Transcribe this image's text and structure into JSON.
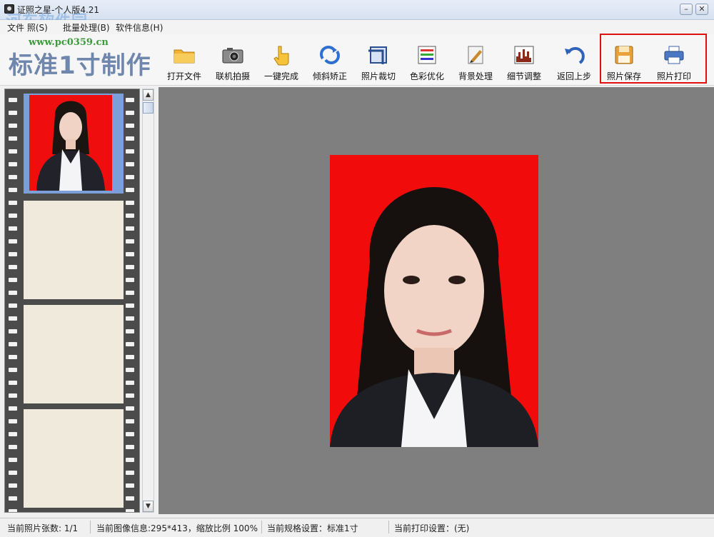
{
  "window": {
    "title": "证照之星-个人版4.21",
    "minimize_symbol": "–",
    "close_symbol": "✕",
    "watermark_text": "河东软件园"
  },
  "menu": [
    {
      "label": "文件 照(S)"
    },
    {
      "label": "批量处理(B)"
    },
    {
      "label": "软件信息(H)"
    }
  ],
  "toolbar": {
    "app_title": "标准1寸制作",
    "site_url": "www.pc0359.cn",
    "buttons": [
      {
        "label": "打开文件",
        "icon": "folder-icon"
      },
      {
        "label": "联机拍摄",
        "icon": "camera-icon"
      },
      {
        "label": "一键完成",
        "icon": "hand-icon"
      },
      {
        "label": "倾斜矫正",
        "icon": "rotate-icon"
      },
      {
        "label": "照片裁切",
        "icon": "crop-icon"
      },
      {
        "label": "色彩优化",
        "icon": "color-icon"
      },
      {
        "label": "背景处理",
        "icon": "brush-icon"
      },
      {
        "label": "细节调整",
        "icon": "histogram-icon"
      },
      {
        "label": "返回上步",
        "icon": "undo-icon"
      },
      {
        "label": "照片保存",
        "icon": "floppy-icon"
      },
      {
        "label": "照片打印",
        "icon": "printer-icon"
      }
    ]
  },
  "colors": {
    "photo_background": "#f20b0b",
    "canvas": "#7f7f7f",
    "highlight": "#e01010",
    "title_text": "#6f86ad"
  },
  "status": {
    "photo_count": "当前照片张数: 1/1",
    "image_info": "当前图像信息:295*413，缩放比例 100%",
    "spec": "当前规格设置：标准1寸",
    "print": "当前打印设置：(无)"
  }
}
